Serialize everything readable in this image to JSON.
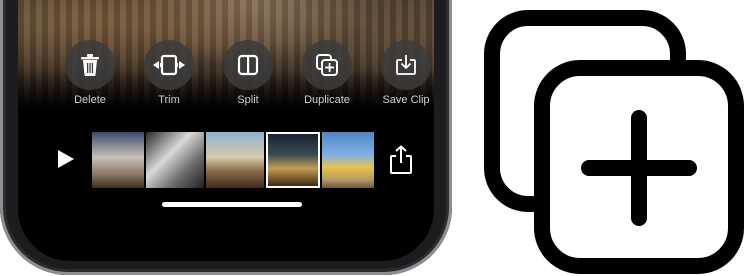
{
  "edit_actions": [
    {
      "label": "Delete",
      "icon": "trash-icon"
    },
    {
      "label": "Trim",
      "icon": "trim-icon"
    },
    {
      "label": "Split",
      "icon": "split-icon"
    },
    {
      "label": "Duplicate",
      "icon": "duplicate-icon"
    },
    {
      "label": "Save Clip",
      "icon": "save-clip-icon"
    }
  ],
  "timeline": {
    "play_icon": "play-icon",
    "share_icon": "share-icon",
    "selected_thumbnail": 4
  },
  "large_icon": "duplicate-icon",
  "colors": {
    "icon_stroke": "#000000",
    "ui_text": "#d0d0d0",
    "button_bg": "#3c3c3c"
  }
}
